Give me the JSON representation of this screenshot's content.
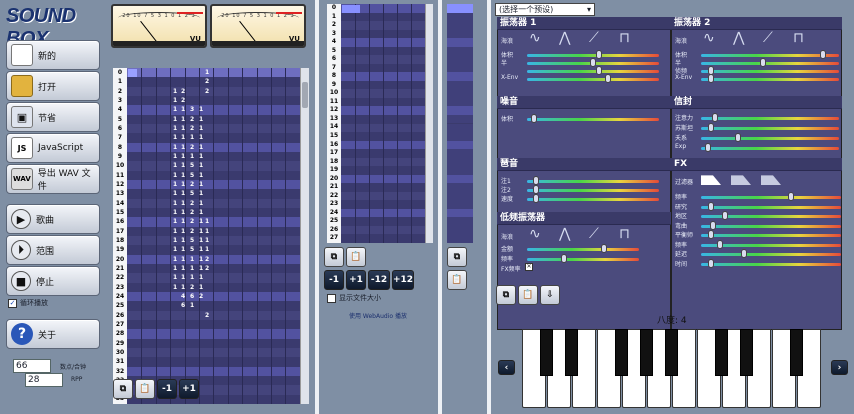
{
  "app": {
    "logo": "SOUND BOX"
  },
  "toolbar": {
    "new_label": "新的",
    "open_label": "打开",
    "save_label": "节省",
    "js_label": "JavaScript",
    "wav_label": "导出 WAV 文件",
    "play_song_label": "歌曲",
    "play_range_label": "范围",
    "stop_label": "停止",
    "loop_label": "循环播放",
    "about_label": "关于",
    "js_icon": "JS",
    "wav_icon": "WAV",
    "help_icon": "?"
  },
  "settings": {
    "rows_per_beat": "66",
    "rows_per_beat_label": "数点/合钟",
    "bpm": "28",
    "bpm_label": "RPP"
  },
  "vu": {
    "left_label": "VU",
    "right_label": "VU",
    "scale": "20 10 7 5 3 1 0 1 2 3"
  },
  "pattern": {
    "rows": [
      "0",
      "1",
      "2",
      "3",
      "4",
      "5",
      "6",
      "7",
      "8",
      "9",
      "10",
      "11",
      "12",
      "13",
      "14",
      "15",
      "16",
      "17",
      "18",
      "19",
      "20",
      "21",
      "22",
      "23",
      "24",
      "25",
      "26",
      "27",
      "28",
      "29",
      "30",
      "31",
      "32",
      "33",
      "34",
      "35"
    ],
    "col1": [
      "",
      "",
      "1",
      "1",
      "1",
      "1",
      "1",
      "1",
      "1",
      "1",
      "1",
      "1",
      "1",
      "1",
      "1",
      "1",
      "1",
      "1",
      "1",
      "1",
      "1",
      "1",
      "1",
      "1",
      "",
      "",
      "",
      "",
      "",
      "",
      "",
      "",
      "",
      "",
      "",
      ""
    ],
    "col2": [
      "",
      "",
      "2",
      "2",
      "1",
      "1",
      "1",
      "1",
      "1",
      "1",
      "1",
      "1",
      "1",
      "1",
      "1",
      "1",
      "1",
      "1",
      "1",
      "1",
      "1",
      "1",
      "1",
      "1",
      "4",
      "6",
      "",
      "",
      "",
      "",
      "",
      "",
      "",
      "",
      "",
      ""
    ],
    "col3": [
      "",
      "",
      "",
      "",
      "3",
      "2",
      "2",
      "1",
      "2",
      "1",
      "5",
      "5",
      "2",
      "5",
      "2",
      "2",
      "2",
      "2",
      "5",
      "5",
      "1",
      "1",
      "1",
      "2",
      "6",
      "1",
      "",
      "",
      "",
      "",
      "",
      "",
      "",
      "",
      "",
      ""
    ],
    "col4": [
      "",
      "",
      "",
      "",
      "1",
      "1",
      "1",
      "1",
      "1",
      "1",
      "1",
      "1",
      "1",
      "1",
      "1",
      "1",
      "1",
      "1",
      "1",
      "1",
      "1",
      "1",
      "1",
      "1",
      "2",
      "",
      "",
      "",
      "",
      "",
      "",
      "",
      "",
      "",
      "",
      ""
    ],
    "col5": [
      "1",
      "2",
      "2",
      "",
      "",
      "",
      "",
      "",
      "",
      "",
      "",
      "",
      "",
      "",
      "",
      "",
      "1",
      "1",
      "1",
      "1",
      "2",
      "2",
      "",
      "",
      "",
      "",
      "2",
      "",
      "",
      "",
      "",
      "",
      "",
      "",
      "",
      ""
    ]
  },
  "pattern_tools": {
    "copy_icon": "copy-icon",
    "paste_icon": "paste-icon",
    "minus_label": "-1",
    "plus_label": "+1"
  },
  "sequencer": {
    "rows": [
      "0",
      "1",
      "2",
      "3",
      "4",
      "5",
      "6",
      "7",
      "8",
      "9",
      "10",
      "11",
      "12",
      "13",
      "14",
      "15",
      "16",
      "17",
      "18",
      "19",
      "20",
      "21",
      "22",
      "23",
      "24",
      "25",
      "26",
      "27"
    ]
  },
  "seq_tools": {
    "minus1": "-1",
    "plus1": "+1",
    "minus12": "-12",
    "plus12": "+12",
    "show_size_label": "显示文件大小",
    "webaudio_note": "使用 WebAudio 播放"
  },
  "preset": {
    "selected": "(选择一个预设)"
  },
  "osc1": {
    "title": "振荡器 1",
    "waveform_label": "海浪",
    "sliders": [
      {
        "label": "体积",
        "value": 0.55
      },
      {
        "label": "半",
        "value": 0.5
      },
      {
        "label": "",
        "value": 0.55
      },
      {
        "label": "X-Env",
        "value": 0.62
      }
    ]
  },
  "osc2": {
    "title": "振荡器 2",
    "waveform_label": "海浪",
    "sliders": [
      {
        "label": "体积",
        "value": 0.9
      },
      {
        "label": "半",
        "value": 0.45
      },
      {
        "label": "侦频",
        "value": 0.05
      },
      {
        "label": "X-Env",
        "value": 0.05
      }
    ]
  },
  "noise": {
    "title": "噪音",
    "sliders": [
      {
        "label": "体积",
        "value": 0.03
      }
    ]
  },
  "envelope": {
    "title": "信封",
    "sliders": [
      {
        "label": "注意力",
        "value": 0.08
      },
      {
        "label": "苏斯坦",
        "value": 0.05
      },
      {
        "label": "夭系",
        "value": 0.26
      },
      {
        "label": "Exp",
        "value": 0.03
      }
    ]
  },
  "arp": {
    "title": "琶音",
    "sliders": [
      {
        "label": "注1",
        "value": 0.05
      },
      {
        "label": "注2",
        "value": 0.05
      },
      {
        "label": "速度",
        "value": 0.05
      }
    ]
  },
  "lfo": {
    "title": "低频振荡器",
    "waveform_label": "海浪",
    "sliders": [
      {
        "label": "金额",
        "value": 0.7
      },
      {
        "label": "频率",
        "value": 0.32
      }
    ],
    "fx_freq_label": "FX频率"
  },
  "fx": {
    "title": "FX",
    "filter_label": "过滤器",
    "sliders": [
      {
        "label": "频率",
        "value": 0.65
      },
      {
        "label": "研究",
        "value": 0.05
      },
      {
        "label": "地区",
        "value": 0.16
      },
      {
        "label": "弯曲",
        "value": 0.07
      },
      {
        "label": "平衡师",
        "value": 0.05
      },
      {
        "label": "频率",
        "value": 0.12
      },
      {
        "label": "延迟",
        "value": 0.3
      },
      {
        "label": "时间",
        "value": 0.05
      }
    ]
  },
  "keyboard": {
    "octave_label": "八度: 4",
    "prev": "‹",
    "next": "›"
  }
}
